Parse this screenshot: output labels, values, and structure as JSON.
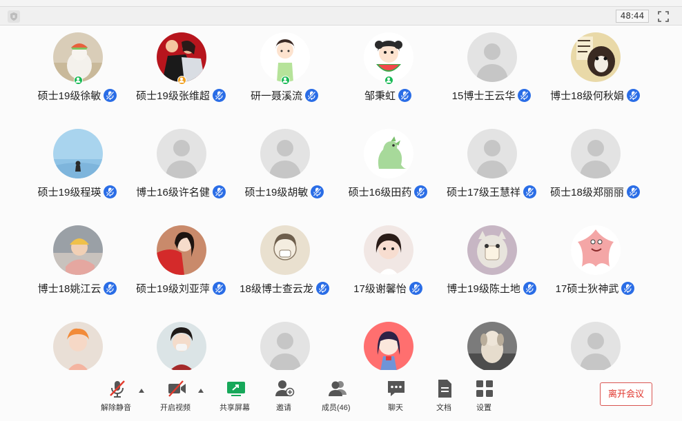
{
  "topbar": {
    "timer": "48:44"
  },
  "participants": [
    {
      "name": "硕士19级徐敏",
      "avatar": "dog-photo-avatar",
      "badge": true
    },
    {
      "name": "硕士19级张维超",
      "avatar": "couple-photo-avatar",
      "badge": true
    },
    {
      "name": "研一聂溪流",
      "avatar": "cartoon-girl-avatar",
      "badge": true
    },
    {
      "name": "邹秉虹",
      "avatar": "watermelon-girl-avatar",
      "badge": true
    },
    {
      "name": "15博士王云华",
      "avatar": "default-avatar",
      "badge": false
    },
    {
      "name": "博士18级何秋娟",
      "avatar": "puppy-photo-avatar",
      "badge": false
    },
    {
      "name": "硕士19级程瑛",
      "avatar": "sky-photo-avatar",
      "badge": false
    },
    {
      "name": "博士16级许名健",
      "avatar": "default-avatar",
      "badge": false
    },
    {
      "name": "硕士19级胡敏",
      "avatar": "default-avatar",
      "badge": false
    },
    {
      "name": "硕士16级田药",
      "avatar": "dinosaur-avatar",
      "badge": false
    },
    {
      "name": "硕士17级王慧祥",
      "avatar": "default-avatar",
      "badge": false
    },
    {
      "name": "硕士18级郑丽丽",
      "avatar": "default-avatar",
      "badge": false
    },
    {
      "name": "博士18姚江云",
      "avatar": "baby-photo-avatar",
      "badge": false
    },
    {
      "name": "硕士19级刘亚萍",
      "avatar": "woman-red-photo-avatar",
      "badge": false
    },
    {
      "name": "18级博士查云龙",
      "avatar": "sketch-avatar",
      "badge": false
    },
    {
      "name": "17级谢馨怡",
      "avatar": "girl-photo-avatar",
      "badge": false
    },
    {
      "name": "博士19级陈土地",
      "avatar": "cat-photo-avatar",
      "badge": false
    },
    {
      "name": "17硕士狄神武",
      "avatar": "starfish-avatar",
      "badge": false
    },
    {
      "name": "",
      "avatar": "girl-selfie-avatar",
      "badge": false
    },
    {
      "name": "",
      "avatar": "masked-woman-avatar",
      "badge": false
    },
    {
      "name": "",
      "avatar": "default-avatar",
      "badge": false
    },
    {
      "name": "",
      "avatar": "anime-girl-avatar",
      "badge": false
    },
    {
      "name": "",
      "avatar": "toy-dog-photo-avatar",
      "badge": false
    },
    {
      "name": "",
      "avatar": "default-avatar",
      "badge": false
    }
  ],
  "toolbar": {
    "unmute": "解除静音",
    "video": "开启视频",
    "share": "共享屏幕",
    "invite": "邀请",
    "members": "成员(46)",
    "chat": "聊天",
    "docs": "文档",
    "settings": "设置",
    "leave": "离开会议"
  },
  "colors": {
    "accent": "#2a6de6",
    "host_badge": "#19b955",
    "cohost_badge": "#f0a020",
    "leave": "#e0362e",
    "share_icon": "#17a85a"
  }
}
